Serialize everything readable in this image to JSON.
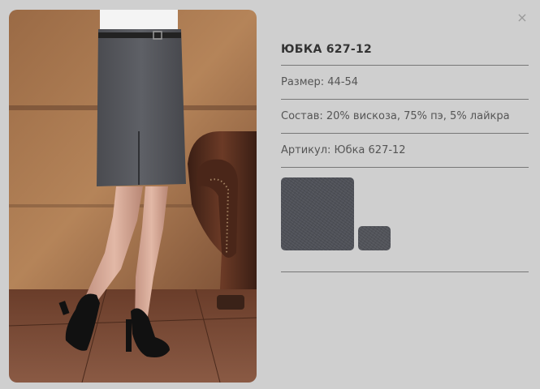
{
  "close_label": "×",
  "product": {
    "title": "ЮБКА 627-12",
    "size": "Размер: 44-54",
    "composition": "Состав: 20% вискоза, 75% пэ, 5% лайкра",
    "article": "Артикул: Юбка 627-12"
  },
  "photo": {
    "subject": "model-in-gray-pencil-skirt"
  },
  "swatches": [
    {
      "color": "#4e5057"
    },
    {
      "color": "#515359"
    }
  ],
  "colors": {
    "background": "#cfcfcf",
    "divider": "#777777",
    "text": "#555555",
    "title": "#333333",
    "fabric": "#4e5057"
  }
}
